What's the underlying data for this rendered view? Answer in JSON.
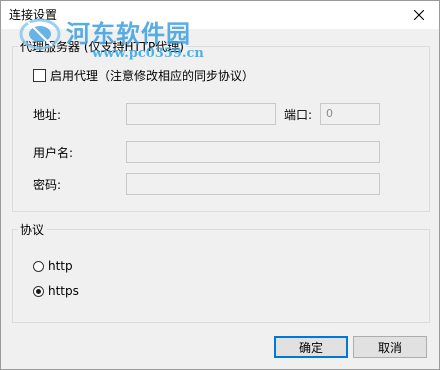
{
  "window": {
    "title": "连接设置",
    "close_icon": "close-icon"
  },
  "watermark": {
    "site_name": "河东软件园",
    "url": "www.pc0359.cn"
  },
  "proxy_group": {
    "label": "代理服务器 (仅支持HTTP代理)",
    "enable_checkbox": {
      "label": "启用代理（注意修改相应的同步协议）",
      "checked": false
    },
    "address": {
      "label": "地址:",
      "value": ""
    },
    "port": {
      "label": "端口:",
      "value": "0"
    },
    "username": {
      "label": "用户名:",
      "value": ""
    },
    "password": {
      "label": "密码:",
      "value": ""
    }
  },
  "protocol_group": {
    "label": "协议",
    "options": [
      {
        "label": "http",
        "selected": false
      },
      {
        "label": "https",
        "selected": true
      }
    ]
  },
  "buttons": {
    "ok": "确定",
    "cancel": "取消"
  },
  "colors": {
    "background": "#f0f0f0",
    "default_button_border": "#0078d7",
    "watermark": "#3aa0e0"
  }
}
